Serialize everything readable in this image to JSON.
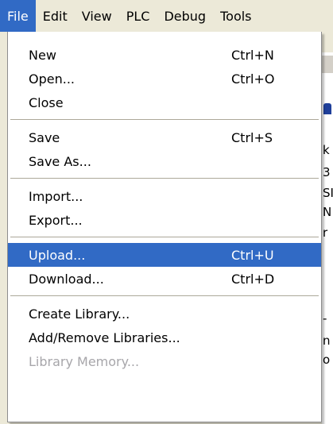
{
  "menubar": {
    "items": [
      {
        "label": "File",
        "active": true
      },
      {
        "label": "Edit"
      },
      {
        "label": "View"
      },
      {
        "label": "PLC"
      },
      {
        "label": "Debug"
      },
      {
        "label": "Tools"
      }
    ]
  },
  "file_menu": {
    "new": {
      "label": "New",
      "shortcut": "Ctrl+N"
    },
    "open": {
      "label": "Open...",
      "shortcut": "Ctrl+O"
    },
    "close": {
      "label": "Close"
    },
    "save": {
      "label": "Save",
      "shortcut": "Ctrl+S"
    },
    "save_as": {
      "label": "Save As..."
    },
    "import": {
      "label": "Import..."
    },
    "export": {
      "label": "Export..."
    },
    "upload": {
      "label": "Upload...",
      "shortcut": "Ctrl+U",
      "highlighted": true
    },
    "download": {
      "label": "Download...",
      "shortcut": "Ctrl+D"
    },
    "create_library": {
      "label": "Create Library..."
    },
    "add_remove_libraries": {
      "label": "Add/Remove Libraries..."
    },
    "library_memory": {
      "label": "Library Memory...",
      "disabled": true
    }
  },
  "background_fragments": [
    "k",
    "3",
    "SI",
    "N",
    "r",
    "-",
    "n",
    "o"
  ],
  "colors": {
    "highlight": "#316ac5",
    "menu_background": "#ffffff",
    "bar_background": "#ece9d8",
    "disabled_text": "#a7a6aa"
  }
}
